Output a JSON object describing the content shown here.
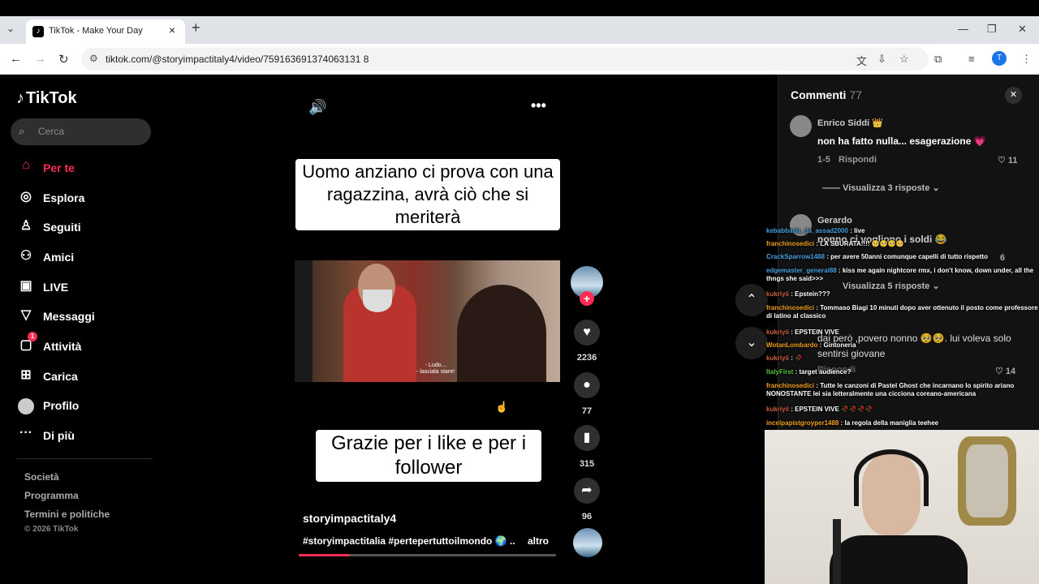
{
  "browser": {
    "tab_title": "TikTok - Make Your Day",
    "url": "tiktok.com/@storyimpactitaly4/video/759163691374063131 8",
    "profile_initial": "T"
  },
  "sidebar": {
    "logo": "TikTok",
    "search_placeholder": "Cerca",
    "items": [
      {
        "label": "Per te",
        "icon": "home-icon"
      },
      {
        "label": "Esplora",
        "icon": "compass-icon"
      },
      {
        "label": "Seguiti",
        "icon": "following-icon"
      },
      {
        "label": "Amici",
        "icon": "friends-icon"
      },
      {
        "label": "LIVE",
        "icon": "live-icon"
      },
      {
        "label": "Messaggi",
        "icon": "message-icon"
      },
      {
        "label": "Attività",
        "icon": "activity-icon",
        "badge": "1"
      },
      {
        "label": "Carica",
        "icon": "upload-icon"
      },
      {
        "label": "Profilo",
        "icon": "profile-icon"
      },
      {
        "label": "Di più",
        "icon": "more-icon"
      }
    ],
    "footer": [
      "Società",
      "Programma",
      "Termini e politiche"
    ],
    "copyright": "© 2026 TikTok"
  },
  "video": {
    "caption_top": "Uomo anziano ci prova con una ragazzina, avrà ciò che si meriterà",
    "subtitle": "- Ludo...\n- lasciala stare!",
    "caption_bottom": "Grazie per i like e per i follower",
    "author": "storyimpactitaly4",
    "description": "#storyimpactitalia #pertepertuttoilmondo 🌍 ...",
    "more_label": "altro",
    "progress": 0.2
  },
  "actions": {
    "likes": "2236",
    "comments": "77",
    "saves": "315",
    "shares": "96"
  },
  "comments": {
    "title": "Commenti",
    "count": "77",
    "items": [
      {
        "user": "Enrico Siddi 👑",
        "text": "non ha fatto nulla... esagerazione 💗",
        "date": "1-5",
        "reply": "Rispondi",
        "likes": "11",
        "view_replies": "Visualizza 3 risposte"
      },
      {
        "user": "Gerardo",
        "text": "nonno ci vogliono i soldi 😂",
        "likes": "6",
        "view_replies": "Visualizza 5 risposte"
      },
      {
        "text": "dai però ,povero nonno 🥺🥺. lui voleva solo sentirsi giovane",
        "reply": "Rispondi",
        "likes": "14"
      }
    ]
  },
  "chat": [
    {
      "user": "kebabbaria_da_assad2000",
      "text": " : live",
      "color": "ub"
    },
    {
      "user": "franchinosedici",
      "text": " : LA SBURATA!!!! 🥺🥺🥺🥺",
      "color": "ua"
    },
    {
      "user": "CrackSparrow1488",
      "text": " : per avere 50anni comunque capelli di tutto rispetto",
      "color": "ub"
    },
    {
      "user": "edgemaster_general88",
      "text": " : kiss me again nightcore rmx, i don't know, down under, all the thngs she said>>>",
      "color": "ub"
    },
    {
      "user": "kukriyii",
      "text": " : Epstein???",
      "color": "u"
    },
    {
      "user": "franchinosedici",
      "text": " : Tommaso Biagi 10 minuti dopo aver ottenuto il posto come professore di latino al classico",
      "color": "ua"
    },
    {
      "user": "kukriyii",
      "text": " : EPSTEIN VIVE",
      "color": "u"
    },
    {
      "user": "WotanLombardo",
      "text": " : Gintoneria",
      "color": "ua"
    },
    {
      "user": "kukriyii",
      "text": " : 🥀",
      "color": "u"
    },
    {
      "user": "ItalyFirst",
      "text": " : target audience?",
      "color": "ug"
    },
    {
      "user": "franchinosedici",
      "text": " : Tutte le canzoni di Pastel Ghost che incarnano lo spirito ariano NONOSTANTE lei sia letteralmente una cicciona coreano-americana",
      "color": "ua"
    },
    {
      "user": "kukriyii",
      "text": " : EPSTEIN VIVE 🥀🥀🥀🥀",
      "color": "u"
    },
    {
      "user": "incelpapistgroyper1488",
      "text": " : la regola della maniglia teehee",
      "color": "ua"
    }
  ]
}
